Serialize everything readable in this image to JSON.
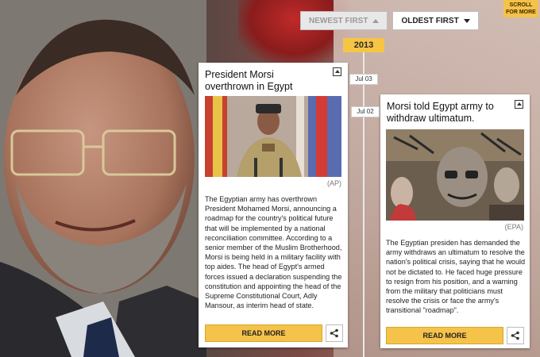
{
  "controls": {
    "newest_first": "NEWEST FIRST",
    "oldest_first": "OLDEST FIRST",
    "scroll_more": "SCROLL FOR MORE"
  },
  "timeline": {
    "year": "2013",
    "date_1": "Jul 03",
    "date_2": "Jul 02"
  },
  "cards": [
    {
      "title": "President Morsi overthrown in Egypt",
      "credit": "(AP)",
      "body": "The Egyptian army has overthrown President Mohamed Morsi, announcing a roadmap for the country's political future that will be implemented by a national reconciliation committee. According to a senior member of the Muslim Brotherhood, Morsi is being held in a military facility with top aides. The head of Egypt's armed forces issued a declaration suspending the constitution and appointing the head of the Supreme Constitutional Court, Adly Mansour, as interim head of state.",
      "read_more": "READ MORE"
    },
    {
      "title": "Morsi told Egypt army to withdraw ultimatum.",
      "credit": "(EPA)",
      "body": "The Egyptian presiden has demanded the army withdraws an ultimatum to resolve the nation's political crisis, saying that he would not be dictated to. He faced huge pressure to resign from his position, and a warning from the military that politicians must resolve the crisis or face the army's transitional \"roadmap\".",
      "read_more": "READ MORE"
    }
  ],
  "colors": {
    "accent": "#f5c24a"
  },
  "icons": [
    "collapse-icon",
    "share-icon",
    "chevron-up-icon",
    "chevron-down-icon"
  ]
}
